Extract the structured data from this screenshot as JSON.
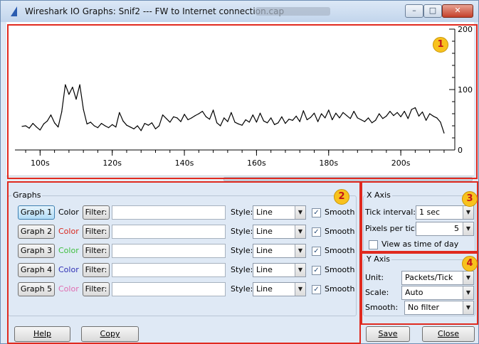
{
  "window": {
    "title": "Wireshark IO Graphs: Snif2 --- FW to Internet connection.cap",
    "minimize_glyph": "–",
    "maximize_glyph": "□",
    "close_glyph": "✕"
  },
  "chart_data": {
    "type": "line",
    "title": "",
    "xlabel": "",
    "ylabel": "",
    "x_ticks": [
      "100s",
      "120s",
      "140s",
      "160s",
      "180s",
      "200s"
    ],
    "y_ticks": [
      "200",
      "100",
      "0"
    ],
    "xlim": [
      95,
      213
    ],
    "ylim": [
      0,
      200
    ],
    "series": [
      {
        "name": "",
        "color": "#000000",
        "x": [
          95,
          96,
          97,
          98,
          99,
          100,
          101,
          102,
          103,
          104,
          105,
          106,
          107,
          108,
          109,
          110,
          111,
          112,
          113,
          114,
          115,
          116,
          117,
          118,
          119,
          120,
          121,
          122,
          123,
          124,
          125,
          126,
          127,
          128,
          129,
          130,
          131,
          132,
          133,
          134,
          135,
          136,
          137,
          138,
          139,
          140,
          141,
          142,
          143,
          144,
          145,
          146,
          147,
          148,
          149,
          150,
          151,
          152,
          153,
          154,
          155,
          156,
          157,
          158,
          159,
          160,
          161,
          162,
          163,
          164,
          165,
          166,
          167,
          168,
          169,
          170,
          171,
          172,
          173,
          174,
          175,
          176,
          177,
          178,
          179,
          180,
          181,
          182,
          183,
          184,
          185,
          186,
          187,
          188,
          189,
          190,
          191,
          192,
          193,
          194,
          195,
          196,
          197,
          198,
          199,
          200,
          201,
          202,
          203,
          204,
          205,
          206,
          207,
          208,
          209,
          210,
          211,
          212
        ],
        "y": [
          39,
          40,
          36,
          44,
          38,
          33,
          43,
          48,
          58,
          45,
          38,
          63,
          108,
          92,
          104,
          84,
          108,
          67,
          43,
          46,
          40,
          37,
          44,
          40,
          37,
          42,
          38,
          62,
          48,
          41,
          38,
          35,
          40,
          32,
          44,
          41,
          45,
          35,
          40,
          58,
          52,
          46,
          55,
          53,
          47,
          59,
          50,
          53,
          57,
          60,
          64,
          55,
          51,
          66,
          45,
          40,
          53,
          47,
          62,
          46,
          43,
          41,
          50,
          46,
          58,
          46,
          61,
          48,
          45,
          53,
          42,
          45,
          55,
          44,
          51,
          49,
          56,
          47,
          65,
          50,
          54,
          61,
          47,
          60,
          53,
          66,
          50,
          61,
          53,
          62,
          57,
          52,
          64,
          53,
          50,
          47,
          53,
          45,
          49,
          60,
          52,
          56,
          64,
          57,
          62,
          55,
          64,
          52,
          67,
          70,
          56,
          63,
          49,
          60,
          56,
          53,
          46,
          28
        ]
      }
    ]
  },
  "callouts": [
    "1",
    "2",
    "3",
    "4"
  ],
  "graphs_panel": {
    "title": "Graphs",
    "color_label": "Color",
    "filter_label": "Filter:",
    "style_label": "Style:",
    "smooth_label": "Smooth",
    "rows": [
      {
        "button": "Graph 1",
        "color": "#000000",
        "style": "Line",
        "smooth": "✓"
      },
      {
        "button": "Graph 2",
        "color": "#d9261c",
        "style": "Line",
        "smooth": "✓"
      },
      {
        "button": "Graph 3",
        "color": "#3fbf3f",
        "style": "Line",
        "smooth": "✓"
      },
      {
        "button": "Graph 4",
        "color": "#2f2fb5",
        "style": "Line",
        "smooth": "✓"
      },
      {
        "button": "Graph 5",
        "color": "#e06bb0",
        "style": "Line",
        "smooth": "✓"
      }
    ]
  },
  "x_axis": {
    "title": "X Axis",
    "tick_interval_label": "Tick interval:",
    "tick_interval_value": "1 sec",
    "pixels_per_tick_label": "Pixels per tick:",
    "pixels_per_tick_value": "5",
    "view_as_time_of_day_label": "View as time of day"
  },
  "y_axis": {
    "title": "Y Axis",
    "unit_label": "Unit:",
    "unit_value": "Packets/Tick",
    "scale_label": "Scale:",
    "scale_value": "Auto",
    "smooth_label": "Smooth:",
    "smooth_value": "No filter"
  },
  "footer": {
    "help_label": "Help",
    "copy_label": "Copy",
    "save_label": "Save",
    "close_label": "Close"
  },
  "icons": {
    "dropdown_arrow": "▼"
  }
}
